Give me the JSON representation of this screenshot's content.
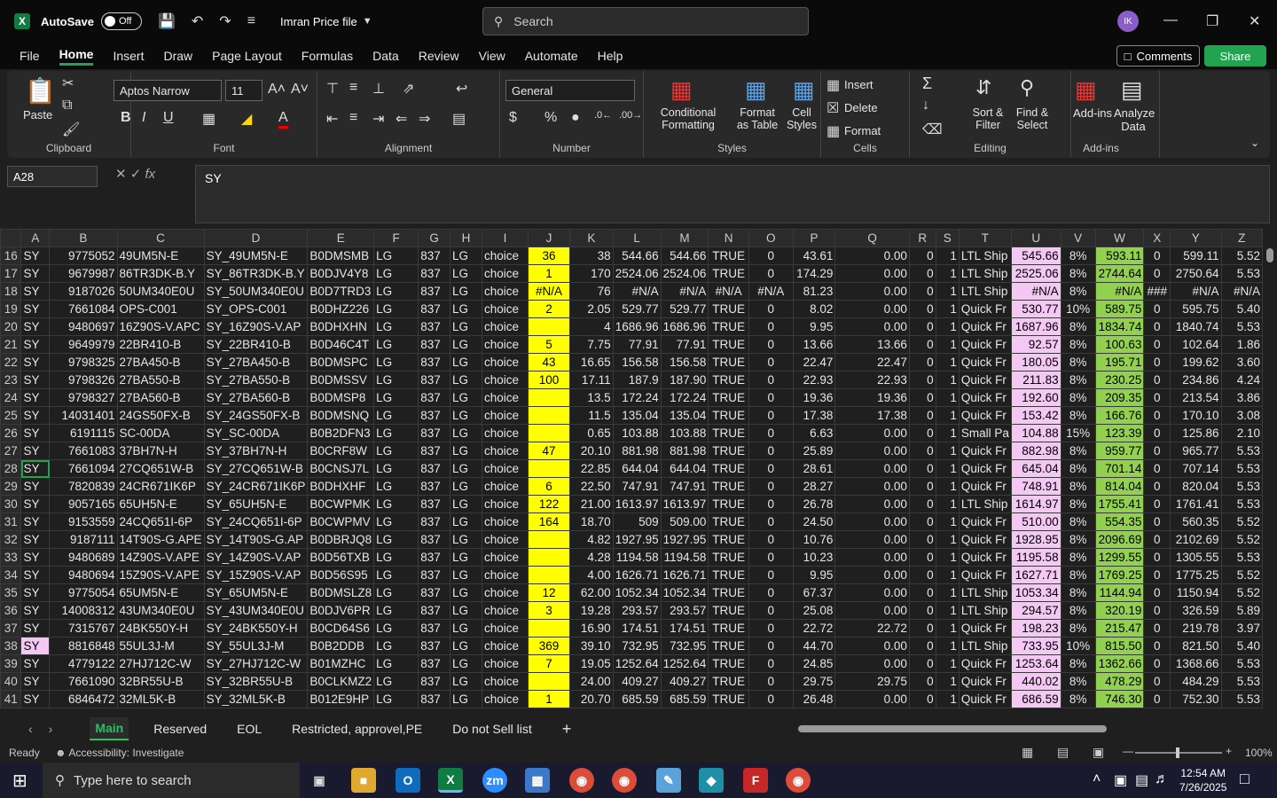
{
  "titlebar": {
    "autosave": "AutoSave",
    "toggle": "Off",
    "filename": "Imran Price file",
    "search_placeholder": "Search",
    "avatar": "IK"
  },
  "menu": [
    "File",
    "Home",
    "Insert",
    "Draw",
    "Page Layout",
    "Formulas",
    "Data",
    "Review",
    "View",
    "Automate",
    "Help"
  ],
  "comments": "Comments",
  "share": "Share",
  "ribbon": {
    "paste": "Paste",
    "clipboard": "Clipboard",
    "font_name": "Aptos Narrow",
    "font_size": "11",
    "font": "Font",
    "alignment": "Alignment",
    "number_format": "General",
    "number": "Number",
    "conditional": "Conditional Formatting",
    "format_table": "Format as Table",
    "cell_styles": "Cell Styles",
    "styles": "Styles",
    "insert": "Insert",
    "delete": "Delete",
    "format": "Format",
    "cells": "Cells",
    "sort": "Sort & Filter",
    "find": "Find & Select",
    "editing": "Editing",
    "addins": "Add-ins",
    "addins_group": "Add-ins",
    "analyze": "Analyze Data"
  },
  "formula": {
    "namebox": "A28",
    "content": "SY"
  },
  "columns": [
    "A",
    "B",
    "C",
    "D",
    "E",
    "F",
    "G",
    "H",
    "I",
    "J",
    "K",
    "L",
    "M",
    "N",
    "O",
    "P",
    "Q",
    "R",
    "S",
    "T",
    "U",
    "V",
    "W",
    "X",
    "Y",
    "Z"
  ],
  "rows": [
    [
      "16",
      "SY",
      "9775052",
      "49UM5N-E",
      "SY_49UM5N-E",
      "B0DMSMB",
      "LG",
      "837",
      "LG",
      "choice",
      "36",
      "38",
      "544.66",
      "544.66",
      "TRUE",
      "0",
      "43.61",
      "0.00",
      "0",
      "1",
      "LTL Ship",
      "545.66",
      "8%",
      "593.11",
      "0",
      "599.11",
      "5.52"
    ],
    [
      "17",
      "SY",
      "9679987",
      "86TR3DK-B.Y",
      "SY_86TR3DK-B.Y",
      "B0DJV4Y8",
      "LG",
      "837",
      "LG",
      "choice",
      "1",
      "170",
      "2524.06",
      "2524.06",
      "TRUE",
      "0",
      "174.29",
      "0.00",
      "0",
      "1",
      "LTL Ship",
      "2525.06",
      "8%",
      "2744.64",
      "0",
      "2750.64",
      "5.53"
    ],
    [
      "18",
      "SY",
      "9187026",
      "50UM340E0U",
      "SY_50UM340E0U",
      "B0D7TRD3",
      "LG",
      "837",
      "LG",
      "choice",
      "#N/A",
      "76",
      "#N/A",
      "#N/A",
      "#N/A",
      "#N/A",
      "81.23",
      "0.00",
      "0",
      "1",
      "LTL Ship",
      "#N/A",
      "8%",
      "#N/A",
      "###",
      "#N/A",
      "#N/A"
    ],
    [
      "19",
      "SY",
      "7661084",
      "OPS-C001",
      "SY_OPS-C001",
      "B0DHZ226",
      "LG",
      "837",
      "LG",
      "choice",
      "2",
      "2.05",
      "529.77",
      "529.77",
      "TRUE",
      "0",
      "8.02",
      "0.00",
      "0",
      "1",
      "Quick Fr",
      "530.77",
      "10%",
      "589.75",
      "0",
      "595.75",
      "5.40"
    ],
    [
      "20",
      "SY",
      "9480697",
      "16Z90S-V.APC",
      "SY_16Z90S-V.AP",
      "B0DHXHN",
      "LG",
      "837",
      "LG",
      "choice",
      "",
      "4",
      "1686.96",
      "1686.96",
      "TRUE",
      "0",
      "9.95",
      "0.00",
      "0",
      "1",
      "Quick Fr",
      "1687.96",
      "8%",
      "1834.74",
      "0",
      "1840.74",
      "5.53"
    ],
    [
      "21",
      "SY",
      "9649979",
      "22BR410-B",
      "SY_22BR410-B",
      "B0D46C4T",
      "LG",
      "837",
      "LG",
      "choice",
      "5",
      "7.75",
      "77.91",
      "77.91",
      "TRUE",
      "0",
      "13.66",
      "13.66",
      "0",
      "1",
      "Quick Fr",
      "92.57",
      "8%",
      "100.63",
      "0",
      "102.64",
      "1.86"
    ],
    [
      "22",
      "SY",
      "9798325",
      "27BA450-B",
      "SY_27BA450-B",
      "B0DMSPC",
      "LG",
      "837",
      "LG",
      "choice",
      "43",
      "16.65",
      "156.58",
      "156.58",
      "TRUE",
      "0",
      "22.47",
      "22.47",
      "0",
      "1",
      "Quick Fr",
      "180.05",
      "8%",
      "195.71",
      "0",
      "199.62",
      "3.60"
    ],
    [
      "23",
      "SY",
      "9798326",
      "27BA550-B",
      "SY_27BA550-B",
      "B0DMSSV",
      "LG",
      "837",
      "LG",
      "choice",
      "100",
      "17.11",
      "187.9",
      "187.90",
      "TRUE",
      "0",
      "22.93",
      "22.93",
      "0",
      "1",
      "Quick Fr",
      "211.83",
      "8%",
      "230.25",
      "0",
      "234.86",
      "4.24"
    ],
    [
      "24",
      "SY",
      "9798327",
      "27BA560-B",
      "SY_27BA560-B",
      "B0DMSP8",
      "LG",
      "837",
      "LG",
      "choice",
      "",
      "13.5",
      "172.24",
      "172.24",
      "TRUE",
      "0",
      "19.36",
      "19.36",
      "0",
      "1",
      "Quick Fr",
      "192.60",
      "8%",
      "209.35",
      "0",
      "213.54",
      "3.86"
    ],
    [
      "25",
      "SY",
      "14031401",
      "24GS50FX-B",
      "SY_24GS50FX-B",
      "B0DMSNQ",
      "LG",
      "837",
      "LG",
      "choice",
      "",
      "11.5",
      "135.04",
      "135.04",
      "TRUE",
      "0",
      "17.38",
      "17.38",
      "0",
      "1",
      "Quick Fr",
      "153.42",
      "8%",
      "166.76",
      "0",
      "170.10",
      "3.08"
    ],
    [
      "26",
      "SY",
      "6191115",
      "SC-00DA",
      "SY_SC-00DA",
      "B0B2DFN3",
      "LG",
      "837",
      "LG",
      "choice",
      "",
      "0.65",
      "103.88",
      "103.88",
      "TRUE",
      "0",
      "6.63",
      "0.00",
      "0",
      "1",
      "Small Pa",
      "104.88",
      "15%",
      "123.39",
      "0",
      "125.86",
      "2.10"
    ],
    [
      "27",
      "SY",
      "7661083",
      "37BH7N-H",
      "SY_37BH7N-H",
      "B0CRF8W",
      "LG",
      "837",
      "LG",
      "choice",
      "47",
      "20.10",
      "881.98",
      "881.98",
      "TRUE",
      "0",
      "25.89",
      "0.00",
      "0",
      "1",
      "Quick Fr",
      "882.98",
      "8%",
      "959.77",
      "0",
      "965.77",
      "5.53"
    ],
    [
      "28",
      "SY",
      "7661094",
      "27CQ651W-B",
      "SY_27CQ651W-B",
      "B0CNSJ7L",
      "LG",
      "837",
      "LG",
      "choice",
      "",
      "22.85",
      "644.04",
      "644.04",
      "TRUE",
      "0",
      "28.61",
      "0.00",
      "0",
      "1",
      "Quick Fr",
      "645.04",
      "8%",
      "701.14",
      "0",
      "707.14",
      "5.53"
    ],
    [
      "29",
      "SY",
      "7820839",
      "24CR671IK6P",
      "SY_24CR671IK6P",
      "B0DHXHF",
      "LG",
      "837",
      "LG",
      "choice",
      "6",
      "22.50",
      "747.91",
      "747.91",
      "TRUE",
      "0",
      "28.27",
      "0.00",
      "0",
      "1",
      "Quick Fr",
      "748.91",
      "8%",
      "814.04",
      "0",
      "820.04",
      "5.53"
    ],
    [
      "30",
      "SY",
      "9057165",
      "65UH5N-E",
      "SY_65UH5N-E",
      "B0CWPMK",
      "LG",
      "837",
      "LG",
      "choice",
      "122",
      "21.00",
      "1613.97",
      "1613.97",
      "TRUE",
      "0",
      "26.78",
      "0.00",
      "0",
      "1",
      "LTL Ship",
      "1614.97",
      "8%",
      "1755.41",
      "0",
      "1761.41",
      "5.53"
    ],
    [
      "31",
      "SY",
      "9153559",
      "24CQ651I-6P",
      "SY_24CQ651I-6P",
      "B0CWPMV",
      "LG",
      "837",
      "LG",
      "choice",
      "164",
      "18.70",
      "509",
      "509.00",
      "TRUE",
      "0",
      "24.50",
      "0.00",
      "0",
      "1",
      "Quick Fr",
      "510.00",
      "8%",
      "554.35",
      "0",
      "560.35",
      "5.52"
    ],
    [
      "32",
      "SY",
      "9187111",
      "14T90S-G.APE",
      "SY_14T90S-G.AP",
      "B0DBRJQ8",
      "LG",
      "837",
      "LG",
      "choice",
      "",
      "4.82",
      "1927.95",
      "1927.95",
      "TRUE",
      "0",
      "10.76",
      "0.00",
      "0",
      "1",
      "Quick Fr",
      "1928.95",
      "8%",
      "2096.69",
      "0",
      "2102.69",
      "5.52"
    ],
    [
      "33",
      "SY",
      "9480689",
      "14Z90S-V.APE",
      "SY_14Z90S-V.AP",
      "B0D56TXB",
      "LG",
      "837",
      "LG",
      "choice",
      "",
      "4.28",
      "1194.58",
      "1194.58",
      "TRUE",
      "0",
      "10.23",
      "0.00",
      "0",
      "1",
      "Quick Fr",
      "1195.58",
      "8%",
      "1299.55",
      "0",
      "1305.55",
      "5.53"
    ],
    [
      "34",
      "SY",
      "9480694",
      "15Z90S-V.APE",
      "SY_15Z90S-V.AP",
      "B0D56S95",
      "LG",
      "837",
      "LG",
      "choice",
      "",
      "4.00",
      "1626.71",
      "1626.71",
      "TRUE",
      "0",
      "9.95",
      "0.00",
      "0",
      "1",
      "Quick Fr",
      "1627.71",
      "8%",
      "1769.25",
      "0",
      "1775.25",
      "5.52"
    ],
    [
      "35",
      "SY",
      "9775054",
      "65UM5N-E",
      "SY_65UM5N-E",
      "B0DMSLZ8",
      "LG",
      "837",
      "LG",
      "choice",
      "12",
      "62.00",
      "1052.34",
      "1052.34",
      "TRUE",
      "0",
      "67.37",
      "0.00",
      "0",
      "1",
      "LTL Ship",
      "1053.34",
      "8%",
      "1144.94",
      "0",
      "1150.94",
      "5.52"
    ],
    [
      "36",
      "SY",
      "14008312",
      "43UM340E0U",
      "SY_43UM340E0U",
      "B0DJV6PR",
      "LG",
      "837",
      "LG",
      "choice",
      "3",
      "19.28",
      "293.57",
      "293.57",
      "TRUE",
      "0",
      "25.08",
      "0.00",
      "0",
      "1",
      "LTL Ship",
      "294.57",
      "8%",
      "320.19",
      "0",
      "326.59",
      "5.89"
    ],
    [
      "37",
      "SY",
      "7315767",
      "24BK550Y-H",
      "SY_24BK550Y-H",
      "B0CD64S6",
      "LG",
      "837",
      "LG",
      "choice",
      "",
      "16.90",
      "174.51",
      "174.51",
      "TRUE",
      "0",
      "22.72",
      "22.72",
      "0",
      "1",
      "Quick Fr",
      "198.23",
      "8%",
      "215.47",
      "0",
      "219.78",
      "3.97"
    ],
    [
      "38",
      "SY",
      "8816848",
      "55UL3J-M",
      "SY_55UL3J-M",
      "B0B2DDB",
      "LG",
      "837",
      "LG",
      "choice",
      "369",
      "39.10",
      "732.95",
      "732.95",
      "TRUE",
      "0",
      "44.70",
      "0.00",
      "0",
      "1",
      "LTL Ship",
      "733.95",
      "10%",
      "815.50",
      "0",
      "821.50",
      "5.40"
    ],
    [
      "39",
      "SY",
      "4779122",
      "27HJ712C-W",
      "SY_27HJ712C-W",
      "B01MZHC",
      "LG",
      "837",
      "LG",
      "choice",
      "7",
      "19.05",
      "1252.64",
      "1252.64",
      "TRUE",
      "0",
      "24.85",
      "0.00",
      "0",
      "1",
      "Quick Fr",
      "1253.64",
      "8%",
      "1362.66",
      "0",
      "1368.66",
      "5.53"
    ],
    [
      "40",
      "SY",
      "7661090",
      "32BR55U-B",
      "SY_32BR55U-B",
      "B0CLKMZ2",
      "LG",
      "837",
      "LG",
      "choice",
      "",
      "24.00",
      "409.27",
      "409.27",
      "TRUE",
      "0",
      "29.75",
      "29.75",
      "0",
      "1",
      "Quick Fr",
      "440.02",
      "8%",
      "478.29",
      "0",
      "484.29",
      "5.53"
    ],
    [
      "41",
      "SY",
      "6846472",
      "32ML5K-B",
      "SY_32ML5K-B",
      "B012E9HP",
      "LG",
      "837",
      "LG",
      "choice",
      "1",
      "20.70",
      "685.59",
      "685.59",
      "TRUE",
      "0",
      "26.48",
      "0.00",
      "0",
      "1",
      "Quick Fr",
      "686.59",
      "8%",
      "746.30",
      "0",
      "752.30",
      "5.53"
    ]
  ],
  "sheets": [
    "Main",
    "Reserved",
    "EOL",
    "Restricted, approvel,PE",
    "Do not Sell list"
  ],
  "status": {
    "ready": "Ready",
    "accessibility": "Accessibility: Investigate",
    "zoom": "100%"
  },
  "taskbar": {
    "search": "Type here to search",
    "time": "12:54 AM",
    "date": "7/26/2025"
  },
  "colors": {
    "accent": "#22a34f",
    "yellow": "#ffff00",
    "pink": "#f4c7f4",
    "green": "#92d050"
  }
}
